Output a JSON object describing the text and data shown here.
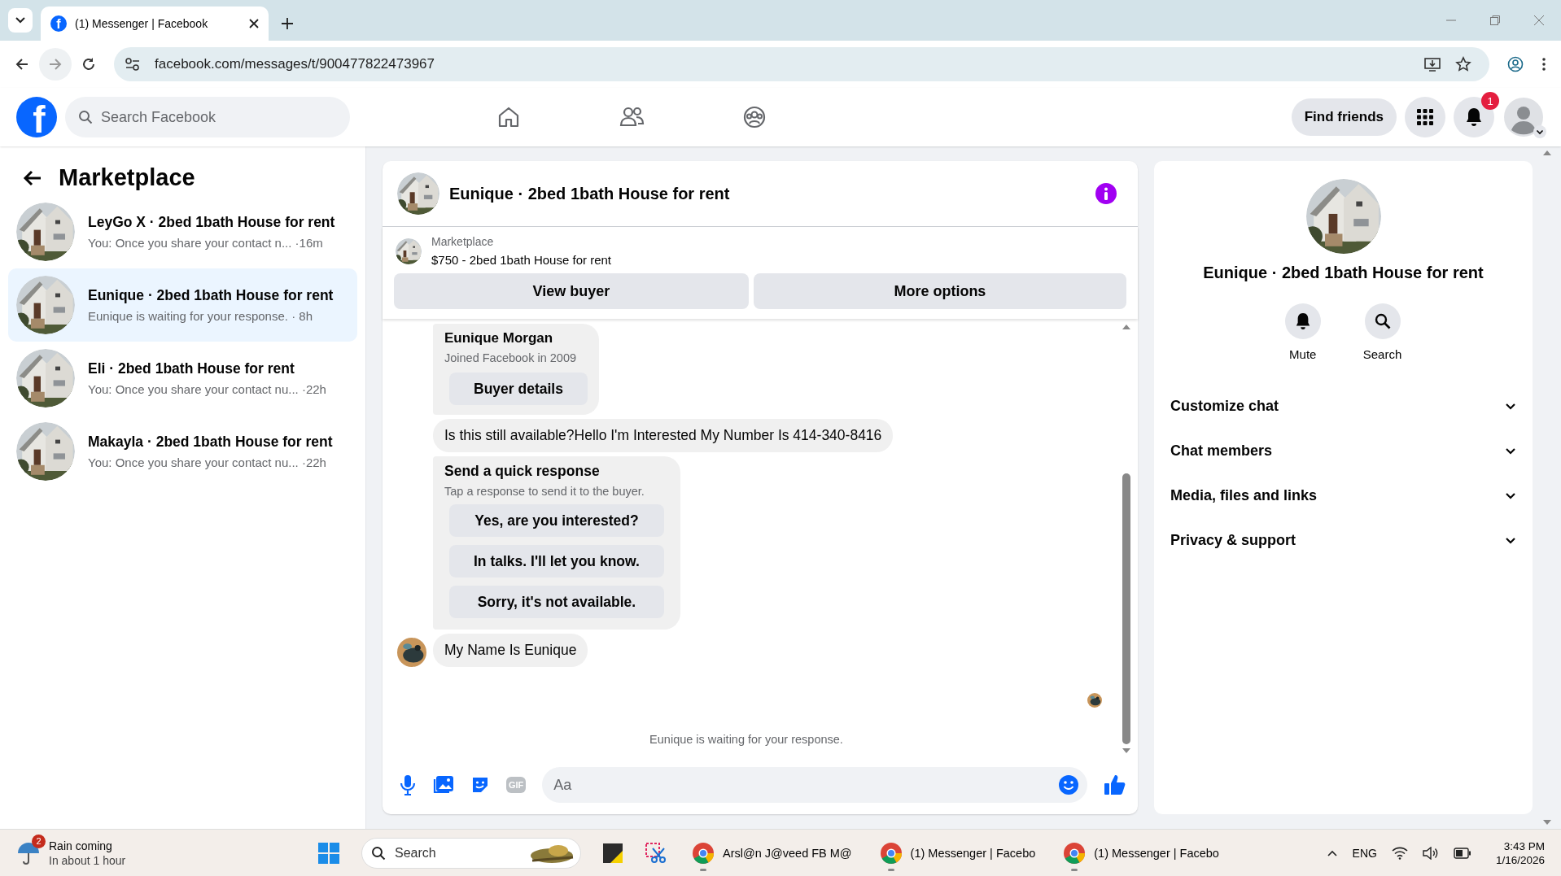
{
  "browser": {
    "tab": {
      "favicon": "f",
      "title": "(1) Messenger | Facebook"
    },
    "url": "facebook.com/messages/t/900477822473967"
  },
  "header": {
    "logo": "f",
    "search_placeholder": "Search Facebook",
    "find_friends": "Find friends",
    "notification_count": "1"
  },
  "sidebar": {
    "title": "Marketplace",
    "conversations": [
      {
        "name": "LeyGo X · 2bed 1bath House for rent",
        "preview": "You: Once you share your contact n...",
        "time": "·16m",
        "selected": false
      },
      {
        "name": "Eunique · 2bed 1bath House for rent",
        "preview": "Eunique is waiting for your response.",
        "time": "· 8h",
        "selected": true
      },
      {
        "name": "Eli · 2bed 1bath House for rent",
        "preview": "You: Once you share your contact nu...",
        "time": "·22h",
        "selected": false
      },
      {
        "name": "Makayla · 2bed 1bath House for rent",
        "preview": "You: Once you share your contact nu...",
        "time": "·22h",
        "selected": false
      }
    ]
  },
  "chat": {
    "title": "Eunique · 2bed 1bath House for rent",
    "listing": {
      "source": "Marketplace",
      "title": "$750 - 2bed 1bath House for rent"
    },
    "actions": [
      "View buyer",
      "More options"
    ],
    "messages": [
      {
        "kind": "profile",
        "name": "Eunique Morgan",
        "subtitle": "Joined Facebook in 2009",
        "button": "Buyer details"
      },
      {
        "kind": "text",
        "text": "Is this still available?Hello I'm Interested My Number Is 414-340-8416",
        "avatar": false
      },
      {
        "kind": "quick",
        "title": "Send a quick response",
        "subtitle": "Tap a response to send it to the buyer.",
        "options": [
          "Yes, are you interested?",
          "In talks. I'll let you know.",
          "Sorry, it's not available."
        ]
      },
      {
        "kind": "text",
        "text": "My Name Is Eunique",
        "avatar": true
      }
    ],
    "status": "Eunique is waiting for your response.",
    "composer": {
      "gif_label": "GIF",
      "placeholder": "Aa"
    }
  },
  "details": {
    "title": "Eunique · 2bed 1bath House for rent",
    "actions": [
      {
        "kind": "mute",
        "label": "Mute"
      },
      {
        "kind": "search",
        "label": "Search"
      }
    ],
    "sections": [
      "Customize chat",
      "Chat members",
      "Media, files and links",
      "Privacy & support"
    ]
  },
  "taskbar": {
    "weather": {
      "badge": "2",
      "title": "Rain coming",
      "subtitle": "In about 1 hour"
    },
    "search_placeholder": "Search",
    "apps": [
      {
        "label": "Arsl@n J@veed FB M@"
      },
      {
        "label": "(1) Messenger | Facebo"
      },
      {
        "label": "(1) Messenger | Facebo"
      }
    ],
    "language": "ENG",
    "time": "3:43 PM",
    "date": "1/16/2026"
  }
}
